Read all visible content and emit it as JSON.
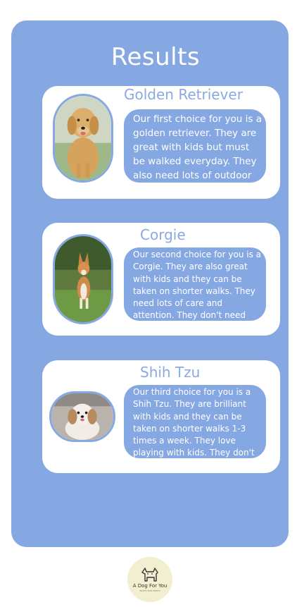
{
  "page": {
    "title": "Results"
  },
  "results": [
    {
      "name": "Golden Retriever",
      "description": "Our first choice for you is a golden retriever. They are great with kids but must be walked everyday. They also need lots of outdoor space."
    },
    {
      "name": "Corgie",
      "description": "Our second choice for you is a Corgie. They are also great with kids and they can be taken on shorter walks. They need lots of care and attention. They don't need much outdoor space."
    },
    {
      "name": "Shih Tzu",
      "description": "Our third choice for you  is a Shih Tzu. They are brilliant with kids and they can be taken on shorter walks 1-3 times a week. They love playing with kids. They don't need any outdoor space."
    }
  ],
  "logo": {
    "brand": "A Dog For You",
    "tagline": "WHAT YOUR MATCH"
  },
  "colors": {
    "accent": "#86a8e2",
    "card": "#ffffff",
    "heading": "#8aa9e3",
    "logo_bg": "#f2efd0"
  }
}
